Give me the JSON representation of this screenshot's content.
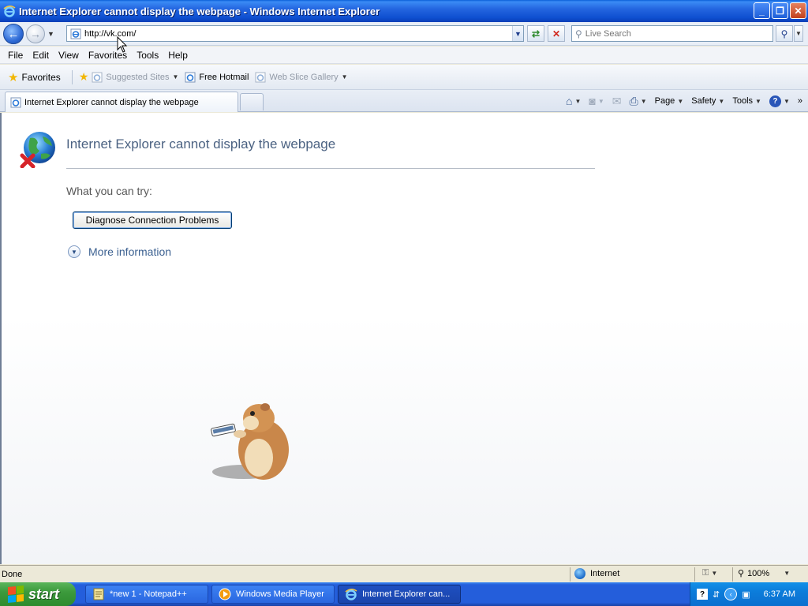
{
  "window": {
    "title": "Internet Explorer cannot display the webpage - Windows Internet Explorer",
    "buttons": {
      "minimize": "_",
      "maximize": "❐",
      "close": "✕"
    }
  },
  "nav": {
    "back_icon": "back-arrow-icon",
    "forward_icon": "forward-arrow-icon",
    "address_value": "http://vk.com/",
    "search_placeholder": "Live Search"
  },
  "menu": {
    "items": [
      "File",
      "Edit",
      "View",
      "Favorites",
      "Tools",
      "Help"
    ]
  },
  "favorites_bar": {
    "favorites_label": "Favorites",
    "items": [
      {
        "label": "Suggested Sites",
        "dim": true,
        "dropdown": true
      },
      {
        "label": "Free Hotmail",
        "dim": false,
        "dropdown": false
      },
      {
        "label": "Web Slice Gallery",
        "dim": true,
        "dropdown": true
      }
    ]
  },
  "tabs": {
    "active_tab_label": "Internet Explorer cannot display the webpage"
  },
  "command_bar": {
    "page": "Page",
    "safety": "Safety",
    "tools": "Tools"
  },
  "content": {
    "heading": "Internet Explorer cannot display the webpage",
    "try_label": "What you can try:",
    "diagnose_button": "Diagnose Connection Problems",
    "more_info": "More information"
  },
  "status": {
    "text": "Done",
    "zone": "Internet",
    "zoom": "100%"
  },
  "taskbar": {
    "start_label": "start",
    "tasks": [
      {
        "label": "*new 1 - Notepad++",
        "active": false
      },
      {
        "label": "Windows Media Player",
        "active": false
      },
      {
        "label": "Internet Explorer can...",
        "active": true
      }
    ],
    "clock": "6:37 AM"
  },
  "colors": {
    "titlebar_blue": "#245EDB",
    "heading_color": "#4B6282",
    "link_color": "#3C6191",
    "start_green": "#3C9A3C"
  }
}
